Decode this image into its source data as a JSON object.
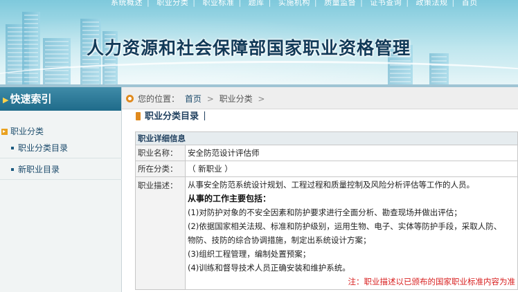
{
  "banner": {
    "nav_items": [
      "系统概述",
      "职业分类",
      "职业标准",
      "题库",
      "实施机构",
      "质量监督",
      "证书查询",
      "政策法规",
      "首页"
    ],
    "title": "人力资源和社会保障部国家职业资格管理"
  },
  "sidebar": {
    "header": "快速索引",
    "category": "职业分类",
    "links": [
      "职业分类目录",
      "新职业目录"
    ]
  },
  "breadcrumb": {
    "prefix": "您的位置：",
    "home": "首页",
    "current": "职业分类",
    "separator": ">"
  },
  "section": {
    "title": "职业分类目录"
  },
  "detail": {
    "header": "职业详细信息",
    "name_label": "职业名称：",
    "name_value": "安全防范设计评估师",
    "category_label": "所在分类：",
    "category_value": "（ 新职业 ）",
    "desc_label": "职业描述：",
    "desc_intro": "从事安全防范系统设计规划、工程过程和质量控制及风险分析评估等工作的人员。",
    "tasks_title": "从事的工作主要包括：",
    "tasks": [
      "(1)对防护对象的不安全因素和防护要求进行全面分析、勘查现场并做出评估；",
      "(2)依据国家相关法规、标准和防护级别，运用生物、电子、实体等防护手段，采取人防、",
      "物防、技防的综合协调措施，制定出系统设计方案；",
      "(3)组织工程管理，编制处置预案；",
      "(4)训练和督导技术人员正确安装和维护系统。"
    ],
    "note": "注：职业描述以已颁布的国家职业标准内容为准"
  },
  "colors": {
    "banner_sky": "#7ec9dc",
    "sidebar_header": "#1f6b8a",
    "accent_orange": "#e08a1e",
    "note_red": "#d81f1f"
  }
}
